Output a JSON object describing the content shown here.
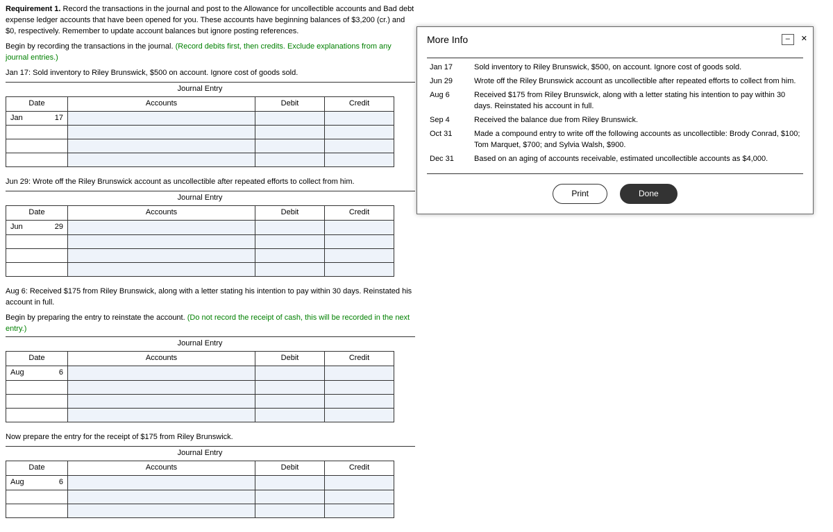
{
  "requirement": {
    "label": "Requirement 1.",
    "text": "Record the transactions in the journal and post to the Allowance for uncollectible accounts and Bad debt expense ledger accounts that have been opened for you. These accounts have beginning balances of $3,200 (cr.) and $0, respectively. Remember to update account balances but ignore posting references."
  },
  "begin_line": {
    "text": "Begin by recording the transactions in the journal. ",
    "green": "(Record debits first, then credits. Exclude explanations from any journal entries.)"
  },
  "je_title": "Journal Entry",
  "headers": {
    "date": "Date",
    "accounts": "Accounts",
    "debit": "Debit",
    "credit": "Credit"
  },
  "entries": [
    {
      "intro": "Jan 17: Sold inventory to Riley Brunswick, $500 on account. Ignore cost of goods sold.",
      "month": "Jan",
      "day": "17"
    },
    {
      "intro": "Jun 29: Wrote off the Riley Brunswick account as uncollectible after repeated efforts to collect from him.",
      "month": "Jun",
      "day": "29"
    },
    {
      "intro": "Aug 6: Received $175 from Riley Brunswick, along with a letter stating his intention to pay within 30 days. Reinstated his account in full.",
      "sub": {
        "text": "Begin by preparing the entry to reinstate the account. ",
        "green": "(Do not record the receipt of cash, this will be recorded in the next entry.)"
      },
      "month": "Aug",
      "day": "6"
    },
    {
      "intro": "Now prepare the entry for the receipt of $175 from Riley Brunswick.",
      "month": "Aug",
      "day": "6"
    }
  ],
  "modal": {
    "title": "More Info",
    "items": [
      {
        "date": "Jan 17",
        "desc": "Sold inventory to Riley Brunswick, $500, on account. Ignore cost of goods sold."
      },
      {
        "date": "Jun 29",
        "desc": "Wrote off the Riley Brunswick account as uncollectible after repeated efforts to collect from him."
      },
      {
        "date": "Aug 6",
        "desc": "Received $175 from Riley Brunswick, along with a letter stating his intention to pay within 30 days. Reinstated his account in full."
      },
      {
        "date": "Sep 4",
        "desc": "Received the balance due from Riley Brunswick."
      },
      {
        "date": "Oct 31",
        "desc": "Made a compound entry to write off the following accounts as uncollectible: Brody Conrad, $100; Tom Marquet, $700; and Sylvia Walsh, $900."
      },
      {
        "date": "Dec 31",
        "desc": "Based on an aging of accounts receivable, estimated uncollectible accounts as $4,000."
      }
    ],
    "print": "Print",
    "done": "Done",
    "min_icon": "–",
    "close_icon": "✕"
  }
}
